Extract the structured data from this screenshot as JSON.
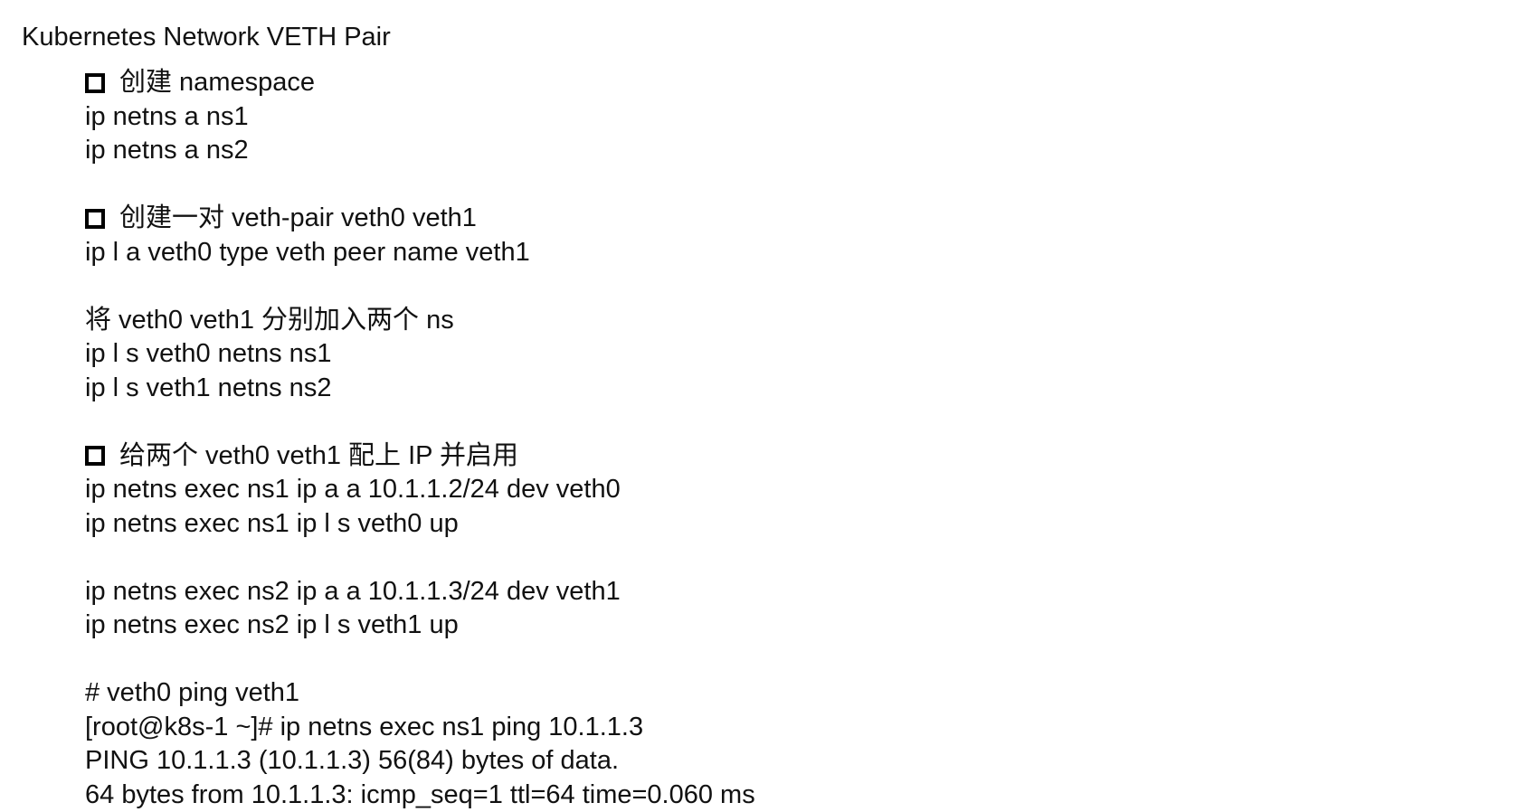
{
  "title": "Kubernetes Network VETH Pair",
  "lines": [
    {
      "text": "创建 namespace",
      "bullet": true
    },
    {
      "text": "ip netns a ns1",
      "bullet": false
    },
    {
      "text": "ip netns a ns2",
      "bullet": false
    },
    {
      "text": "",
      "blank": true
    },
    {
      "text": "创建一对 veth-pair veth0 veth1",
      "bullet": true
    },
    {
      "text": "ip l a veth0 type veth peer name veth1",
      "bullet": false
    },
    {
      "text": "",
      "blank": true
    },
    {
      "text": "将 veth0 veth1 分别加入两个 ns",
      "bullet": false
    },
    {
      "text": "ip l s veth0 netns ns1",
      "bullet": false
    },
    {
      "text": "ip l s veth1 netns ns2",
      "bullet": false
    },
    {
      "text": "",
      "blank": true
    },
    {
      "text": "给两个 veth0 veth1 配上 IP 并启用",
      "bullet": true
    },
    {
      "text": "ip netns exec ns1 ip a a 10.1.1.2/24 dev veth0",
      "bullet": false
    },
    {
      "text": "ip netns exec ns1 ip l s veth0 up",
      "bullet": false
    },
    {
      "text": "",
      "blank": true
    },
    {
      "text": "ip netns exec ns2 ip a a 10.1.1.3/24 dev veth1",
      "bullet": false
    },
    {
      "text": "ip netns exec ns2 ip l s veth1 up",
      "bullet": false
    },
    {
      "text": "",
      "blank": true
    },
    {
      "text": "# veth0 ping veth1",
      "bullet": false
    },
    {
      "text": "[root@k8s-1 ~]# ip netns exec ns1 ping 10.1.1.3",
      "bullet": false
    },
    {
      "text": "PING 10.1.1.3 (10.1.1.3) 56(84) bytes of data.",
      "bullet": false
    },
    {
      "text": "64 bytes from 10.1.1.3: icmp_seq=1 ttl=64 time=0.060 ms",
      "bullet": false
    }
  ]
}
